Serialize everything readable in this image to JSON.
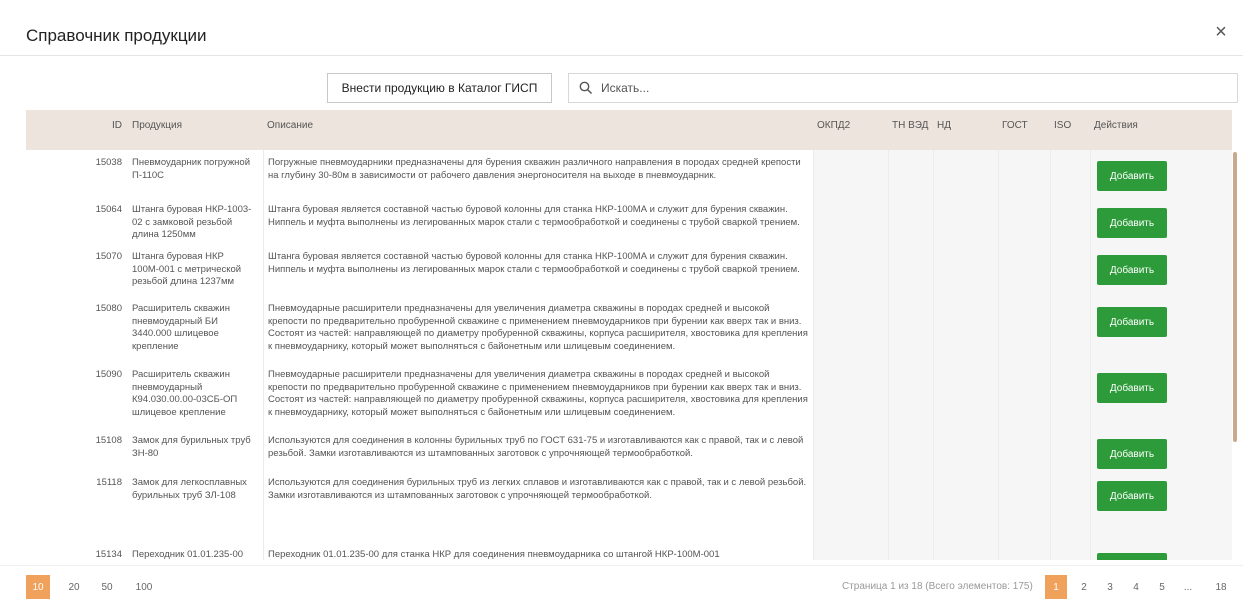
{
  "dialog": {
    "title": "Справочник продукции",
    "close_icon": "close-icon"
  },
  "toolbar": {
    "add_catalog_label": "Внести продукцию в Каталог ГИСП",
    "search_placeholder": "Искать..."
  },
  "table": {
    "headers": {
      "id": "ID",
      "product": "Продукция",
      "description": "Описание",
      "okpd": "ОКПД2",
      "tn_ved": "ТН ВЭД",
      "nd": "НД",
      "gost": "ГОСТ",
      "iso": "ISO",
      "actions": "Действия"
    },
    "add_label": "Добавить",
    "rows": [
      {
        "id": "15038",
        "product": "Пневмоударник погружной П-110С",
        "description": "Погружные пневмоударники предназначены для бурения скважин различного направления в породах средней крепости на глубину 30-80м в зависимости от рабочего давления энергоносителя на выходе в пневмоударник."
      },
      {
        "id": "15064",
        "product": "Штанга буровая НКР-1003-02 с замковой резьбой длина 1250мм",
        "description": "Штанга буровая является составной частью буровой колонны для станка НКР-100МА и служит для бурения скважин. Ниппель и муфта выполнены из легированных марок стали с термообработкой и соединены с трубой сваркой трением."
      },
      {
        "id": "15070",
        "product": "Штанга буровая НКР 100М-001 с метрической резьбой длина 1237мм",
        "description": "Штанга буровая является составной частью буровой колонны для станка НКР-100МА и служит для бурения скважин. Ниппель и муфта выполнены из легированных марок стали с термообработкой и соединены с трубой сваркой трением."
      },
      {
        "id": "15080",
        "product": "Расширитель скважин пневмоударный БИ 3440.000 шлицевое крепление",
        "description": "Пневмоударные расширители предназначены для увеличения диаметра скважины в породах средней и высокой крепости по предварительно пробуренной скважине с применением пневмоударников при бурении как вверх так и вниз. Состоят из частей: направляющей по диаметру пробуренной скважины, корпуса расширителя, хвостовика для крепления к пневмоударнику, который может выполняться с байонетным или шлицевым соединением."
      },
      {
        "id": "15090",
        "product": "Расширитель скважин пневмоударный К94.030.00.00-03СБ-ОП шлицевое крепление",
        "description": "Пневмоударные расширители предназначены для увеличения диаметра скважины в породах средней и высокой крепости по предварительно пробуренной скважине с применением пневмоударников при бурении как вверх так и вниз. Состоят из частей: направляющей по диаметру пробуренной скважины, корпуса расширителя, хвостовика для крепления к пневмоударнику, который может выполняться с байонетным или шлицевым соединением."
      },
      {
        "id": "15108",
        "product": "Замок для бурильных труб ЗН-80",
        "description": "Используются для соединения в колонны бурильных труб по ГОСТ 631-75 и изготавливаются как с правой, так и с левой резьбой. Замки изготавливаются из штампованных заготовок с упрочняющей термообработкой."
      },
      {
        "id": "15118",
        "product": "Замок для легкосплавных бурильных труб ЗЛ-108",
        "description": "Используются для соединения бурильных труб из легких сплавов и изготавливаются как с правой, так и с левой резьбой. Замки изготавливаются из штампованных заготовок с упрочняющей термообработкой."
      },
      {
        "id": "15134",
        "product": "Переходник 01.01.235-00",
        "description": "Переходник 01.01.235-00 для станка НКР для соединения пневмоударника со штангой НКР-100М-001"
      }
    ]
  },
  "pagination": {
    "sizes": [
      "10",
      "20",
      "50",
      "100"
    ],
    "active_size": "10",
    "info": "Страница 1 из 18 (Всего элементов: 175)",
    "pages": [
      "1",
      "2",
      "3",
      "4",
      "5",
      "...",
      "18"
    ],
    "active_page": "1"
  },
  "colors": {
    "accent": "#f0a15c",
    "add_button": "#2e9b3a",
    "header_bg": "#ede4dd"
  }
}
